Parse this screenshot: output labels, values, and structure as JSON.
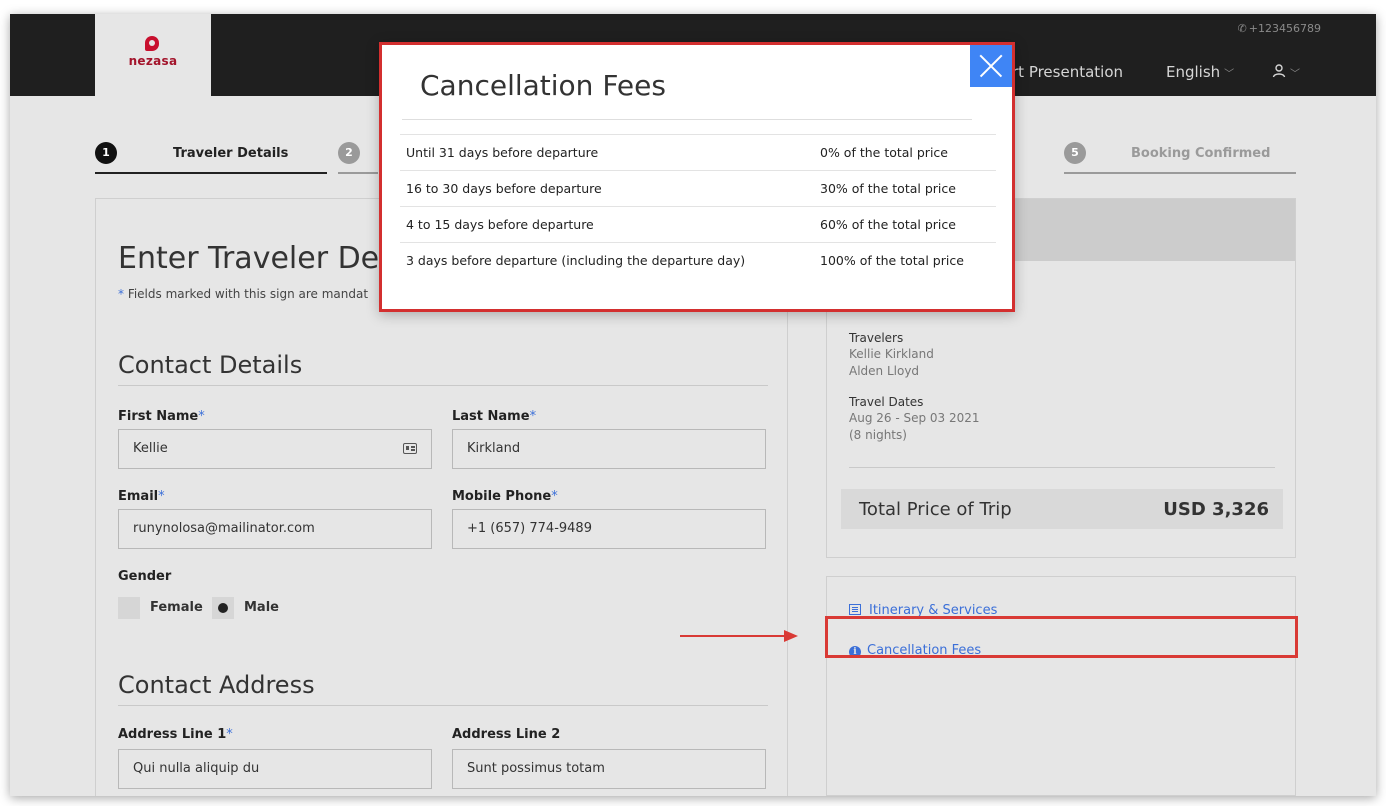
{
  "header": {
    "logo_text": "nezasa",
    "phone": "+123456789",
    "presentation_label": "rt Presentation",
    "language_label": "English",
    "user_icon": "user-icon"
  },
  "steps": [
    {
      "number": "1",
      "label": "Traveler Details"
    },
    {
      "number": "2",
      "label": ""
    },
    {
      "number": "5",
      "label": "Booking Confirmed"
    }
  ],
  "form": {
    "page_title": "Enter Traveler Deta",
    "mandatory_note_star": "*",
    "mandatory_note": " Fields marked with this sign are mandat",
    "contact_section": "Contact Details",
    "first_name_label": "First Name",
    "first_name_value": "Kellie",
    "last_name_label": "Last Name",
    "last_name_value": "Kirkland",
    "email_label": "Email",
    "email_value": "runynolosa@mailinator.com",
    "phone_label": "Mobile Phone",
    "phone_value": "+1 (657) 774-9489",
    "required_mark": "*",
    "gender_label": "Gender",
    "gender_options": [
      "Female",
      "Male"
    ],
    "gender_selected": "Male",
    "address_section": "Contact Address",
    "address1_label": "Address Line 1",
    "address1_value": "Qui nulla aliquip du",
    "address2_label": "Address Line 2",
    "address2_value": "Sunt possimus totam"
  },
  "summary": {
    "travelers_label": "Travelers",
    "travelers": [
      "Kellie Kirkland",
      "Alden Lloyd"
    ],
    "dates_label": "Travel Dates",
    "dates_value": "Aug 26 - Sep 03 2021",
    "nights": "(8 nights)",
    "total_label": "Total Price of Trip",
    "total_value": "USD 3,326"
  },
  "links": {
    "itinerary": "Itinerary & Services",
    "cancellation": "Cancellation Fees"
  },
  "modal": {
    "title": "Cancellation Fees",
    "rows": [
      {
        "period": "Until 31 days before departure",
        "fee": "0% of the total price"
      },
      {
        "period": "16 to 30 days before departure",
        "fee": "30% of the total price"
      },
      {
        "period": "4 to 15 days before departure",
        "fee": "60% of the total price"
      },
      {
        "period": "3 days before departure (including the departure day)",
        "fee": "100% of the total price"
      }
    ]
  },
  "colors": {
    "accent_link": "#3b6fd8",
    "highlight": "#d93a35",
    "close_button": "#3f85f5",
    "brand": "#c8102e"
  }
}
